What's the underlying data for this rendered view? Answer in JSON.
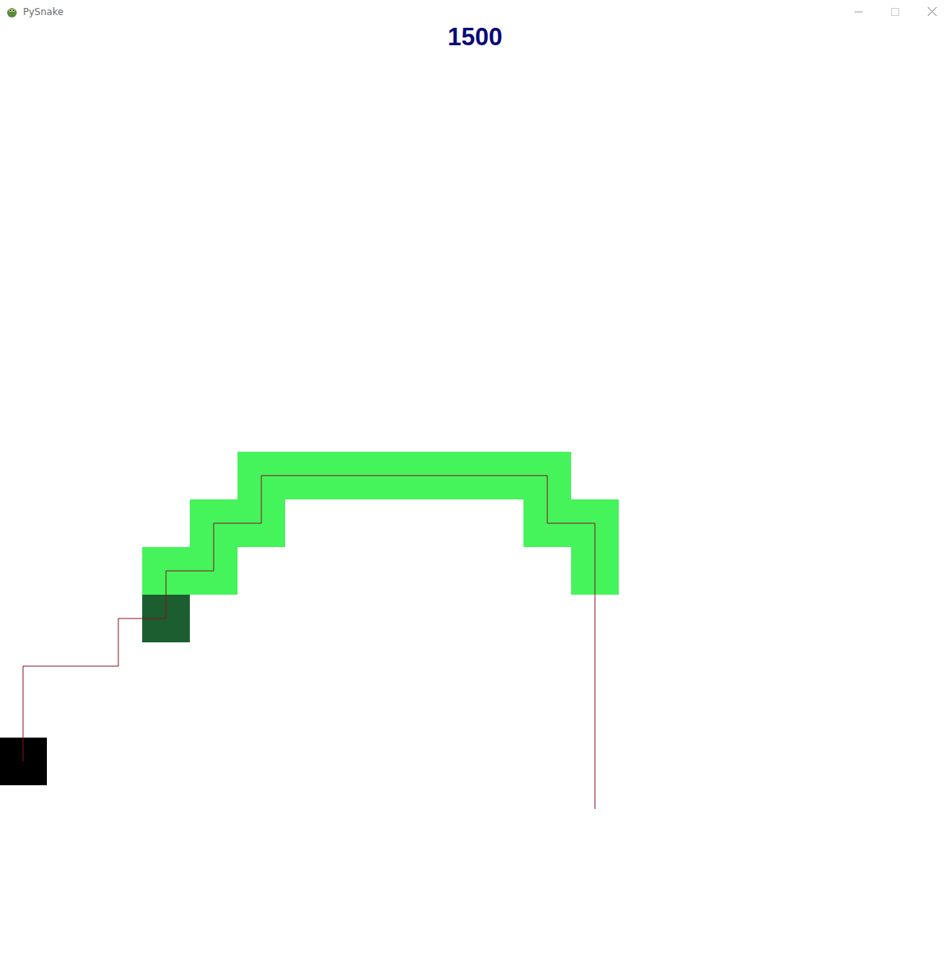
{
  "window": {
    "title": "PySnake"
  },
  "score": "1500",
  "snake": {
    "head": [
      3,
      12
    ],
    "body": [
      [
        3,
        11
      ],
      [
        4,
        11
      ],
      [
        4,
        10
      ],
      [
        5,
        10
      ],
      [
        5,
        9
      ],
      [
        6,
        9
      ],
      [
        7,
        9
      ],
      [
        8,
        9
      ],
      [
        9,
        9
      ],
      [
        10,
        9
      ],
      [
        11,
        9
      ],
      [
        11,
        10
      ],
      [
        12,
        10
      ],
      [
        12,
        11
      ]
    ]
  },
  "food": [
    0,
    15
  ],
  "path": [
    [
      0,
      15
    ],
    [
      0,
      13
    ],
    [
      2,
      13
    ],
    [
      2,
      12
    ],
    [
      3,
      12
    ],
    [
      3,
      11
    ],
    [
      4,
      11
    ],
    [
      4,
      10
    ],
    [
      5,
      10
    ],
    [
      5,
      9
    ],
    [
      11,
      9
    ],
    [
      11,
      10
    ],
    [
      12,
      10
    ],
    [
      12,
      16
    ]
  ]
}
